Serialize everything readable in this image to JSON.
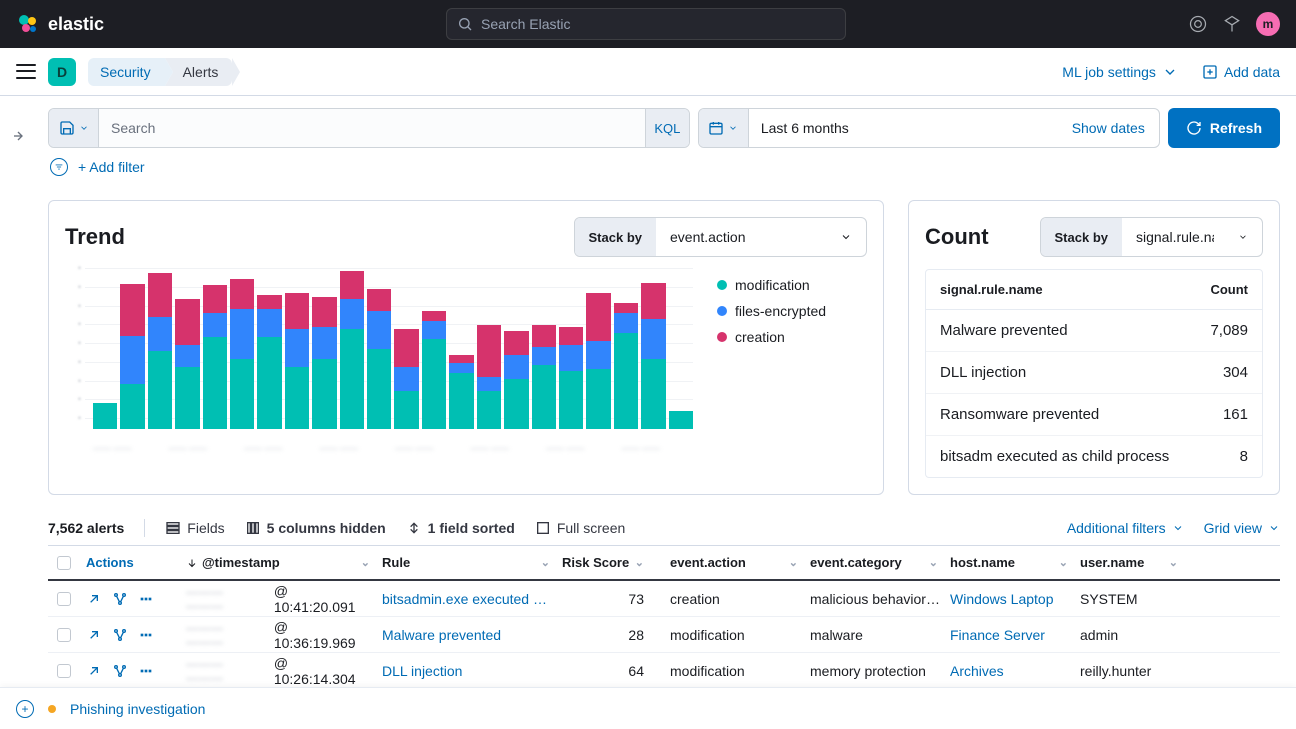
{
  "brand": "elastic",
  "global_search_placeholder": "Search Elastic",
  "avatar_initial": "m",
  "space_initial": "D",
  "breadcrumbs": {
    "security": "Security",
    "alerts": "Alerts"
  },
  "header_actions": {
    "ml_jobs": "ML job settings",
    "add_data": "Add data"
  },
  "query": {
    "placeholder": "Search",
    "language": "KQL"
  },
  "date": {
    "range": "Last 6 months",
    "show_dates": "Show dates"
  },
  "refresh": "Refresh",
  "add_filter": "+ Add filter",
  "trend": {
    "title": "Trend",
    "stack_by_label": "Stack by",
    "stack_by_value": "event.action",
    "legend": {
      "modification": "modification",
      "files_encrypted": "files-encrypted",
      "creation": "creation"
    }
  },
  "count": {
    "title": "Count",
    "stack_by_label": "Stack by",
    "stack_by_value": "signal.rule.nam",
    "header_name": "signal.rule.name",
    "header_count": "Count",
    "rows": [
      {
        "name": "Malware prevented",
        "count": "7,089"
      },
      {
        "name": "DLL injection",
        "count": "304"
      },
      {
        "name": "Ransomware prevented",
        "count": "161"
      },
      {
        "name": "bitsadm executed as child process",
        "count": "8"
      }
    ]
  },
  "alerts": {
    "count": "7,562 alerts",
    "fields": "Fields",
    "columns_hidden": "5 columns hidden",
    "field_sorted": "1 field sorted",
    "full_screen": "Full screen",
    "additional_filters": "Additional filters",
    "grid_view": "Grid view",
    "columns": {
      "actions": "Actions",
      "timestamp": "@timestamp",
      "rule": "Rule",
      "risk": "Risk Score",
      "event_action": "event.action",
      "event_category": "event.category",
      "host_name": "host.name",
      "user_name": "user.name"
    },
    "rows": [
      {
        "ts_time": "@ 10:41:20.091",
        "rule": "bitsadmin.exe executed as …",
        "risk": "73",
        "action": "creation",
        "category": "malicious behavior…",
        "host": "Windows Laptop",
        "user": "SYSTEM"
      },
      {
        "ts_time": "@ 10:36:19.969",
        "rule": "Malware prevented",
        "risk": "28",
        "action": "modification",
        "category": "malware",
        "host": "Finance Server",
        "user": "admin"
      },
      {
        "ts_time": "@ 10:26:14.304",
        "rule": "DLL injection",
        "risk": "64",
        "action": "modification",
        "category": "memory protection",
        "host": "Archives",
        "user": "reilly.hunter"
      }
    ]
  },
  "bottom": {
    "investigation": "Phishing investigation"
  },
  "chart_data": {
    "type": "bar",
    "stacked": true,
    "ylim": [
      0,
      160
    ],
    "series": [
      {
        "name": "modification",
        "color": "#00bfb3"
      },
      {
        "name": "files-encrypted",
        "color": "#3185fc"
      },
      {
        "name": "creation",
        "color": "#d6336c"
      }
    ],
    "bars": [
      {
        "modification": 26,
        "files-encrypted": 0,
        "creation": 0
      },
      {
        "modification": 45,
        "files-encrypted": 48,
        "creation": 52
      },
      {
        "modification": 78,
        "files-encrypted": 34,
        "creation": 44
      },
      {
        "modification": 62,
        "files-encrypted": 22,
        "creation": 46
      },
      {
        "modification": 92,
        "files-encrypted": 24,
        "creation": 28
      },
      {
        "modification": 70,
        "files-encrypted": 50,
        "creation": 30
      },
      {
        "modification": 92,
        "files-encrypted": 28,
        "creation": 14
      },
      {
        "modification": 62,
        "files-encrypted": 38,
        "creation": 36
      },
      {
        "modification": 70,
        "files-encrypted": 32,
        "creation": 30
      },
      {
        "modification": 100,
        "files-encrypted": 30,
        "creation": 28
      },
      {
        "modification": 80,
        "files-encrypted": 38,
        "creation": 22
      },
      {
        "modification": 38,
        "files-encrypted": 24,
        "creation": 38
      },
      {
        "modification": 90,
        "files-encrypted": 18,
        "creation": 10
      },
      {
        "modification": 56,
        "files-encrypted": 10,
        "creation": 8
      },
      {
        "modification": 38,
        "files-encrypted": 14,
        "creation": 52
      },
      {
        "modification": 50,
        "files-encrypted": 24,
        "creation": 24
      },
      {
        "modification": 64,
        "files-encrypted": 18,
        "creation": 22
      },
      {
        "modification": 58,
        "files-encrypted": 26,
        "creation": 18
      },
      {
        "modification": 60,
        "files-encrypted": 28,
        "creation": 48
      },
      {
        "modification": 96,
        "files-encrypted": 20,
        "creation": 10
      },
      {
        "modification": 70,
        "files-encrypted": 40,
        "creation": 36
      },
      {
        "modification": 18,
        "files-encrypted": 0,
        "creation": 0
      }
    ]
  }
}
